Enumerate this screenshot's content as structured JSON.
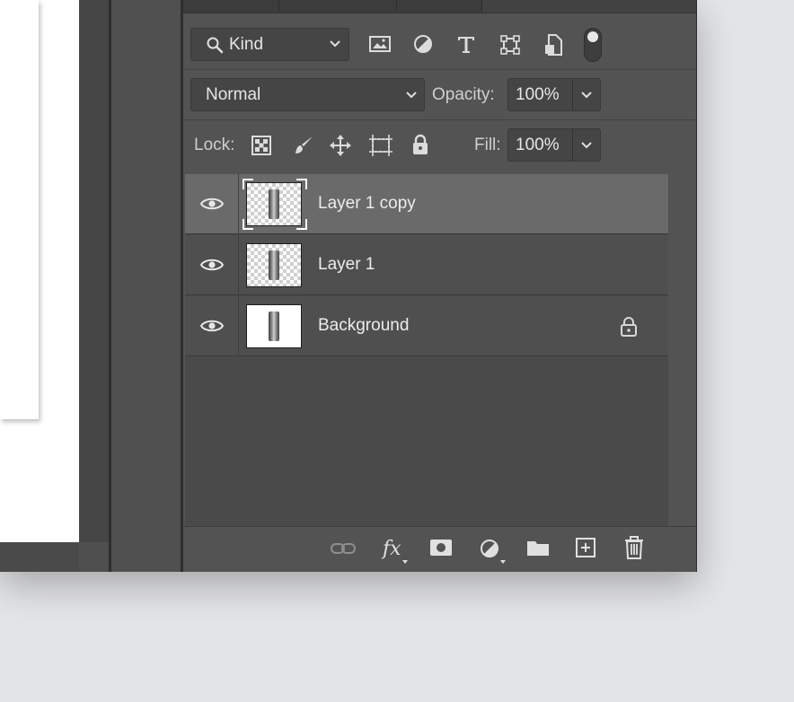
{
  "filter": {
    "kind_label": "Kind"
  },
  "blend": {
    "mode": "Normal",
    "opacity_label": "Opacity:",
    "opacity_value": "100%"
  },
  "lock": {
    "label": "Lock:",
    "fill_label": "Fill:",
    "fill_value": "100%"
  },
  "layers": [
    {
      "name": "Layer 1 copy",
      "selected": true
    },
    {
      "name": "Layer 1",
      "selected": false
    },
    {
      "name": "Background",
      "selected": false,
      "locked": true
    }
  ],
  "colors": {
    "panel": "#535353",
    "selected_row": "#6a6a6a",
    "desktop": "#e4e5e7"
  },
  "icons": {
    "filter_bar": [
      "search-icon",
      "image-filter-icon",
      "adjustment-filter-icon",
      "type-filter-icon",
      "shape-filter-icon",
      "smart-object-filter-icon",
      "filter-toggle-icon"
    ],
    "lock_bar": [
      "lock-transparent-pixels-icon",
      "lock-image-pixels-icon",
      "lock-position-icon",
      "lock-artboard-icon",
      "lock-all-icon"
    ],
    "footer": [
      "link-layers-icon",
      "fx-icon",
      "add-mask-icon",
      "adjustment-layer-icon",
      "new-group-icon",
      "new-layer-icon",
      "delete-layer-icon"
    ]
  }
}
